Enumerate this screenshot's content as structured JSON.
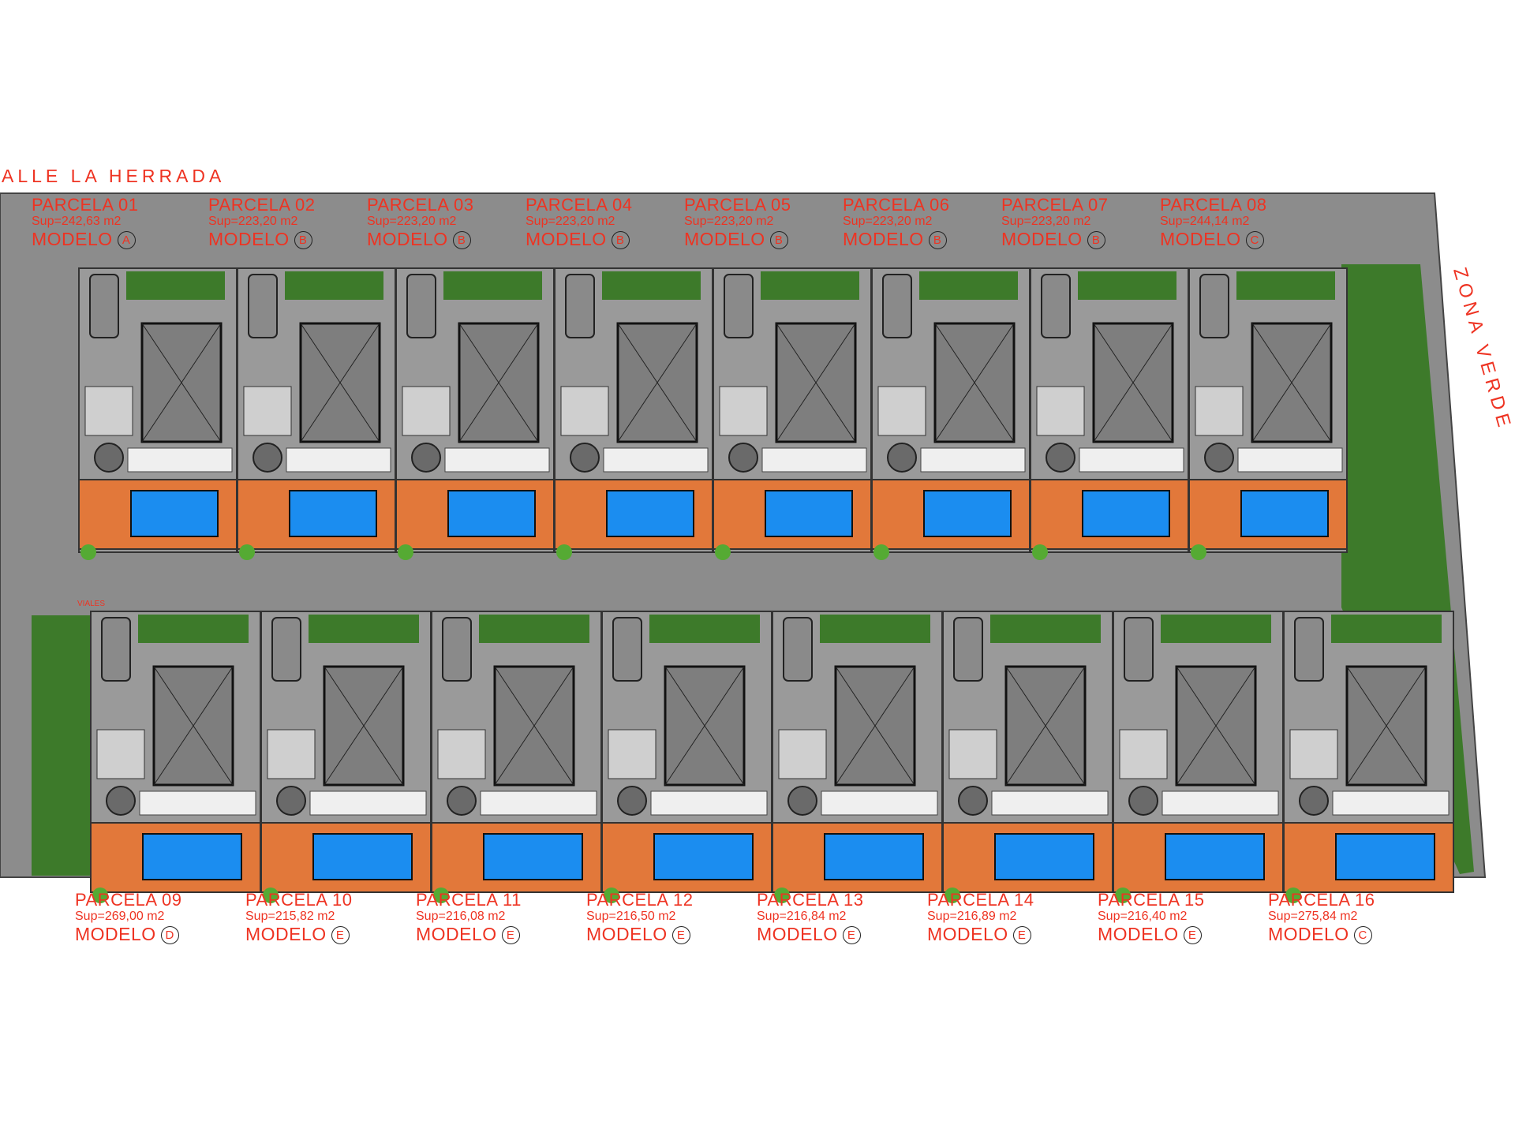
{
  "streets": {
    "top": "ALLE LA HERRADA",
    "right": "ZONA VERDE",
    "small_tag": "VIALES"
  },
  "colors": {
    "road": "#8c8c8c",
    "deck": "#e2783a",
    "pool": "#1b8df0",
    "green": "#3d7a2a",
    "house": "#7e7e7e",
    "label": "#ee3322"
  },
  "top_row": [
    {
      "name": "PARCELA 01",
      "sup": "Sup=242,63 m2",
      "modelo": "MODELO",
      "model": "A"
    },
    {
      "name": "PARCELA 02",
      "sup": "Sup=223,20 m2",
      "modelo": "MODELO",
      "model": "B"
    },
    {
      "name": "PARCELA 03",
      "sup": "Sup=223,20 m2",
      "modelo": "MODELO",
      "model": "B"
    },
    {
      "name": "PARCELA 04",
      "sup": "Sup=223,20 m2",
      "modelo": "MODELO",
      "model": "B"
    },
    {
      "name": "PARCELA 05",
      "sup": "Sup=223,20 m2",
      "modelo": "MODELO",
      "model": "B"
    },
    {
      "name": "PARCELA 06",
      "sup": "Sup=223,20 m2",
      "modelo": "MODELO",
      "model": "B"
    },
    {
      "name": "PARCELA 07",
      "sup": "Sup=223,20 m2",
      "modelo": "MODELO",
      "model": "B"
    },
    {
      "name": "PARCELA 08",
      "sup": "Sup=244,14 m2",
      "modelo": "MODELO",
      "model": "C"
    }
  ],
  "bottom_row": [
    {
      "name": "PARCELA 09",
      "sup": "Sup=269,00 m2",
      "modelo": "MODELO",
      "model": "D"
    },
    {
      "name": "PARCELA 10",
      "sup": "Sup=215,82 m2",
      "modelo": "MODELO",
      "model": "E"
    },
    {
      "name": "PARCELA 11",
      "sup": "Sup=216,08 m2",
      "modelo": "MODELO",
      "model": "E"
    },
    {
      "name": "PARCELA 12",
      "sup": "Sup=216,50 m2",
      "modelo": "MODELO",
      "model": "E"
    },
    {
      "name": "PARCELA 13",
      "sup": "Sup=216,84 m2",
      "modelo": "MODELO",
      "model": "E"
    },
    {
      "name": "PARCELA 14",
      "sup": "Sup=216,89 m2",
      "modelo": "MODELO",
      "model": "E"
    },
    {
      "name": "PARCELA 15",
      "sup": "Sup=216,40 m2",
      "modelo": "MODELO",
      "model": "E"
    },
    {
      "name": "PARCELA 16",
      "sup": "Sup=275,84 m2",
      "modelo": "MODELO",
      "model": "C"
    }
  ]
}
